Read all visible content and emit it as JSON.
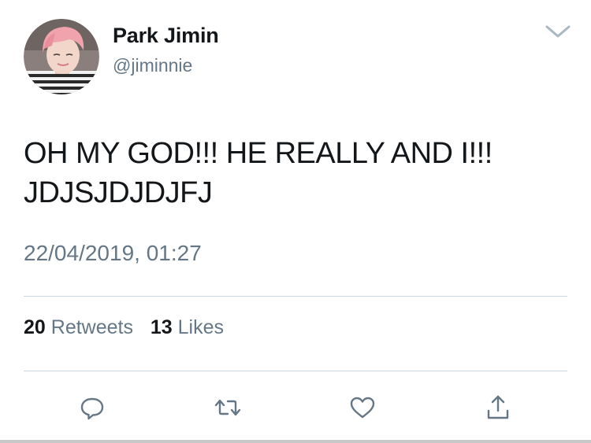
{
  "user": {
    "display_name": "Park Jimin",
    "handle": "@jiminnie"
  },
  "tweet": {
    "text_line1": "OH MY GOD!!! HE REALLY AND I!!!",
    "text_line2": "JDJSJDJDJFJ",
    "timestamp": "22/04/2019, 01:27"
  },
  "stats": {
    "retweets_count": "20",
    "retweets_label": "Retweets",
    "likes_count": "13",
    "likes_label": "Likes"
  },
  "icons": {
    "menu": "chevron-down-icon",
    "reply": "reply-icon",
    "retweet": "retweet-icon",
    "like": "heart-icon",
    "share": "share-icon"
  },
  "colors": {
    "text_primary": "#14171a",
    "text_secondary": "#657786",
    "divider": "#ccd6dd",
    "icon": "#657786"
  }
}
